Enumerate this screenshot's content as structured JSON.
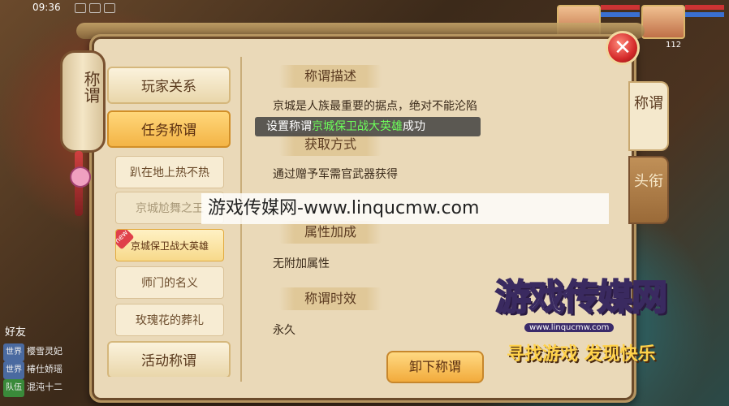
{
  "status": {
    "time": "09:36"
  },
  "hud": {
    "level": "112",
    "friends_label": "好友",
    "chat": [
      {
        "tag": "世界",
        "text": "樱雪灵妃"
      },
      {
        "tag": "世界",
        "text": "椿仕娇瑶"
      },
      {
        "tag": "队伍",
        "text": "混沌十二"
      }
    ]
  },
  "panel": {
    "lantern_title": "称谓",
    "close_symbol": "✕",
    "categories": {
      "player_relations": "玩家关系",
      "quest_titles": "任务称谓",
      "event_titles": "活动称谓"
    },
    "sub_items": [
      "趴在地上热不热",
      "京城尬舞之王",
      "京城保卫战大英雄",
      "师门的名义",
      "玫瑰花的葬礼"
    ],
    "new_badge": "new",
    "sections": {
      "desc_title": "称谓描述",
      "desc_text": "京城是人族最重要的据点，绝对不能沦陷",
      "obtain_title": "获取方式",
      "obtain_text": "通过赠予军需官武器获得",
      "attr_title": "属性加成",
      "attr_text": "无附加属性",
      "time_title": "称谓时效",
      "time_text": "永久"
    },
    "toast": {
      "prefix": "设置称谓",
      "highlight": "京城保卫战大英雄",
      "suffix": "成功"
    },
    "unequip_button": "卸下称谓",
    "tabs": {
      "title_tab": "称谓",
      "head_tab": "头衔"
    }
  },
  "watermark": {
    "banner": "游戏传媒网-www.linqucmw.com",
    "logo_title": "游戏传媒网",
    "logo_url": "www.linqucmw.com",
    "logo_slogan": "寻找游戏 发现快乐"
  },
  "colors": {
    "accent": "#f3b446",
    "toast_highlight": "#6dff5a",
    "close": "#d42a2a"
  }
}
